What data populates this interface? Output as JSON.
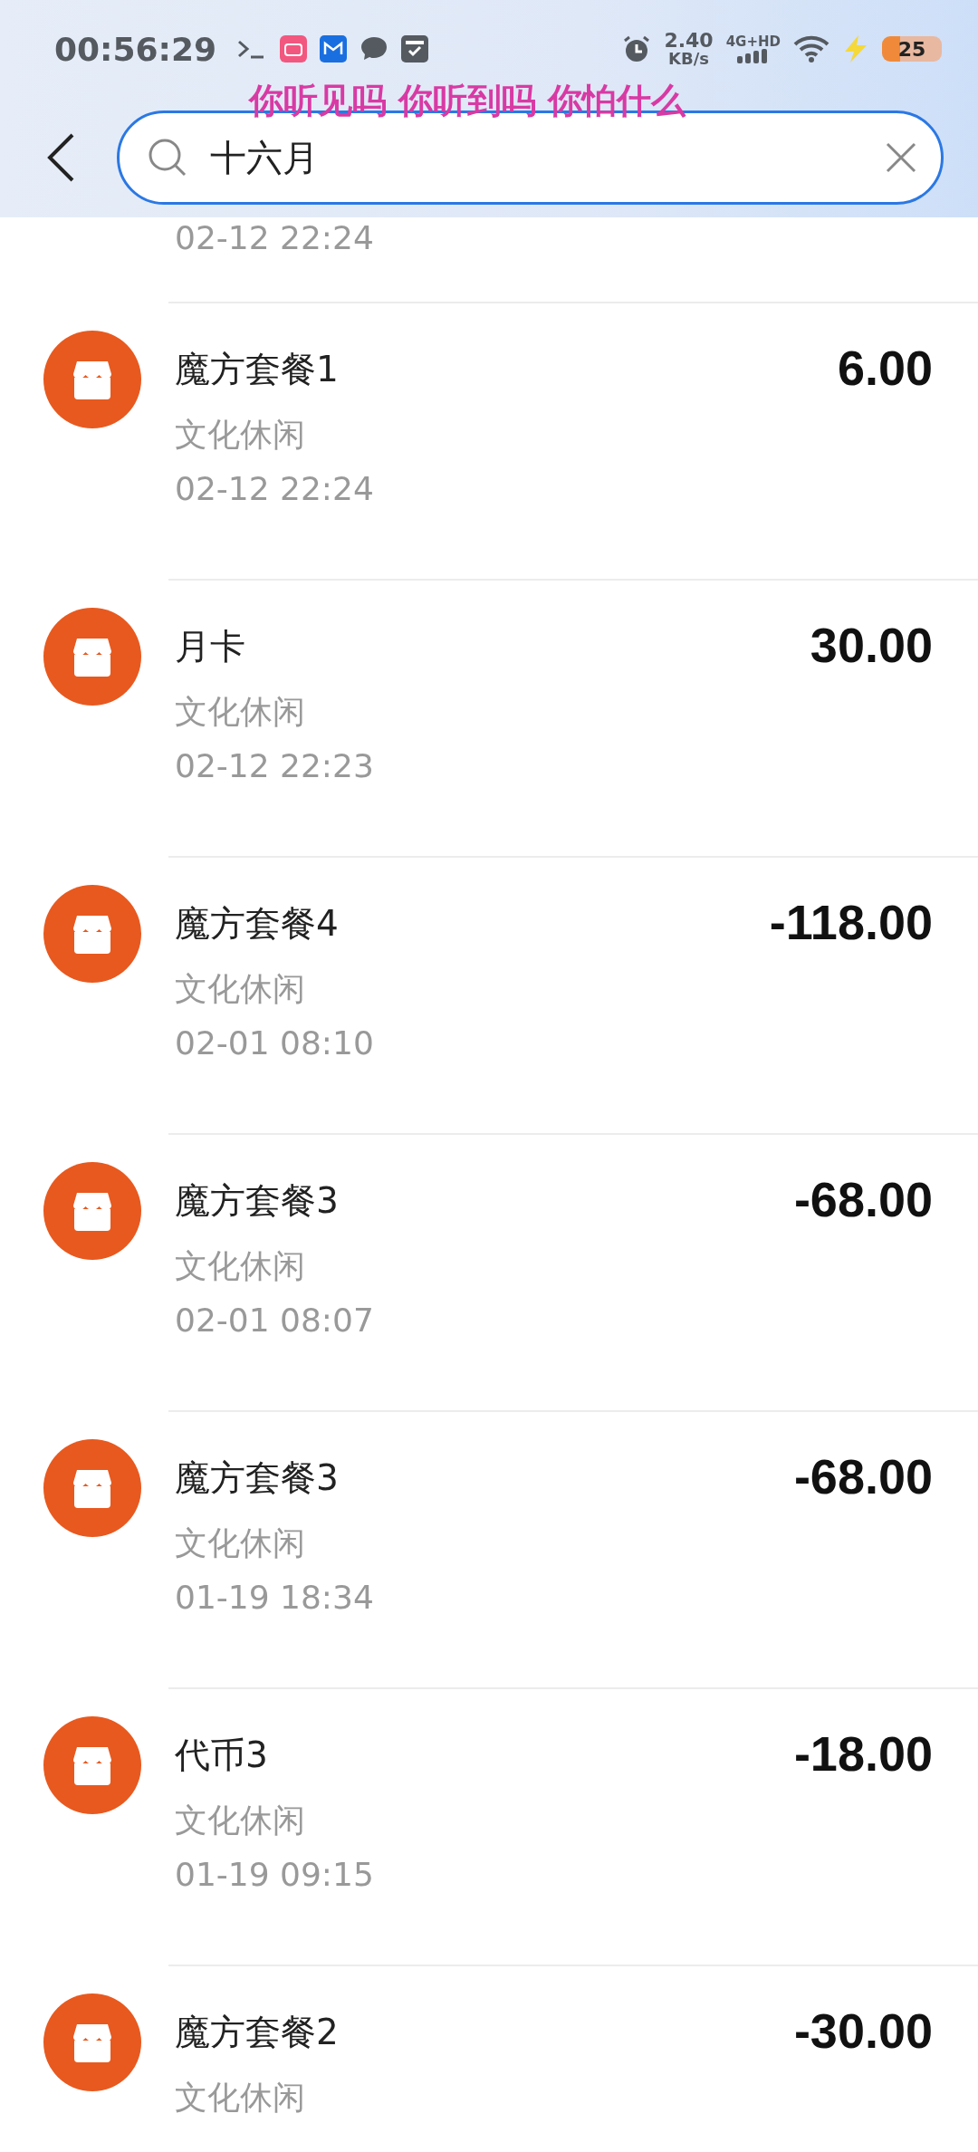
{
  "status_bar": {
    "time": "00:56:29",
    "network_speed": "2.40",
    "speed_unit": "KB/s",
    "network_type": "4G+HD",
    "battery": "25",
    "charging": true
  },
  "lyrics_overlay": "你听见吗 你听到吗 你怕什么",
  "search": {
    "value": "十六月"
  },
  "partial_row": {
    "time": "02-12 22:24"
  },
  "transactions": [
    {
      "title": "魔方套餐1",
      "category": "文化休闲",
      "time": "02-12 22:24",
      "amount": "6.00"
    },
    {
      "title": "月卡",
      "category": "文化休闲",
      "time": "02-12 22:23",
      "amount": "30.00"
    },
    {
      "title": "魔方套餐4",
      "category": "文化休闲",
      "time": "02-01 08:10",
      "amount": "-118.00"
    },
    {
      "title": "魔方套餐3",
      "category": "文化休闲",
      "time": "02-01 08:07",
      "amount": "-68.00"
    },
    {
      "title": "魔方套餐3",
      "category": "文化休闲",
      "time": "01-19 18:34",
      "amount": "-68.00"
    },
    {
      "title": "代币3",
      "category": "文化休闲",
      "time": "01-19 09:15",
      "amount": "-18.00"
    },
    {
      "title": "魔方套餐2",
      "category": "文化休闲",
      "amount": "-30.00"
    }
  ]
}
